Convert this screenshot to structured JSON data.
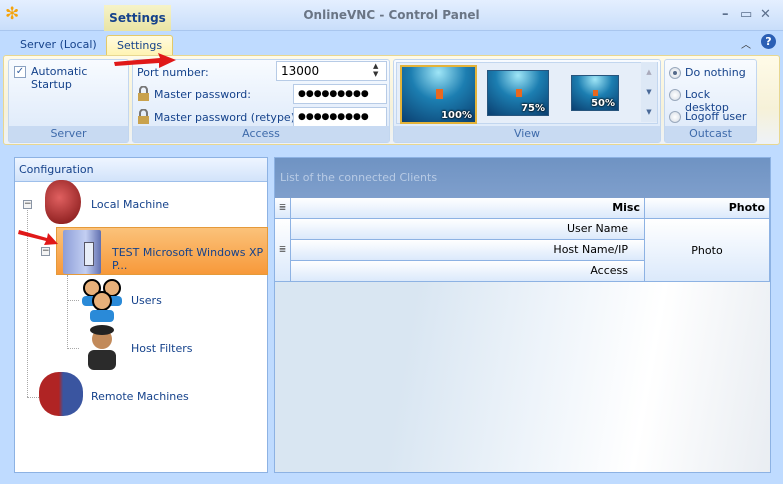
{
  "window": {
    "title": "OnlineVNC - Control Panel",
    "contextual_tab": "Settings"
  },
  "tabs": [
    {
      "label": "Server (Local)"
    },
    {
      "label": "Settings"
    }
  ],
  "ribbon": {
    "server": {
      "label": "Server",
      "automatic_startup": "Automatic Startup",
      "automatic_startup_checked": true
    },
    "access": {
      "label": "Access",
      "port_label": "Port number:",
      "port_value": "13000",
      "master_password_label": "Master password:",
      "master_password_value": "●●●●●●●●●",
      "retype_label": "Master password  (retype):",
      "retype_value": "●●●●●●●●●"
    },
    "view": {
      "label": "View",
      "thumbs": [
        {
          "label": "100%"
        },
        {
          "label": "75%"
        },
        {
          "label": "50%"
        }
      ],
      "selected": "100%"
    },
    "outcast": {
      "label": "Outcast",
      "options": [
        {
          "label": "Do nothing"
        },
        {
          "label": "Lock desktop"
        },
        {
          "label": "Logoff user"
        }
      ],
      "selected": "Do nothing"
    }
  },
  "tree": {
    "header": "Configuration",
    "nodes": [
      {
        "label": "Local Machine"
      },
      {
        "label": "TEST Microsoft Windows XP P..."
      },
      {
        "label": "Users"
      },
      {
        "label": "Host Filters"
      },
      {
        "label": "Remote Machines"
      }
    ]
  },
  "clients": {
    "header": "List of the connected Clients",
    "columns": [
      "Misc",
      "Photo"
    ],
    "rows": [
      "User Name",
      "Host Name/IP",
      "Access"
    ],
    "photo": "Photo"
  },
  "colors": {
    "accent": "#15428b",
    "selected": "#f9a848"
  }
}
